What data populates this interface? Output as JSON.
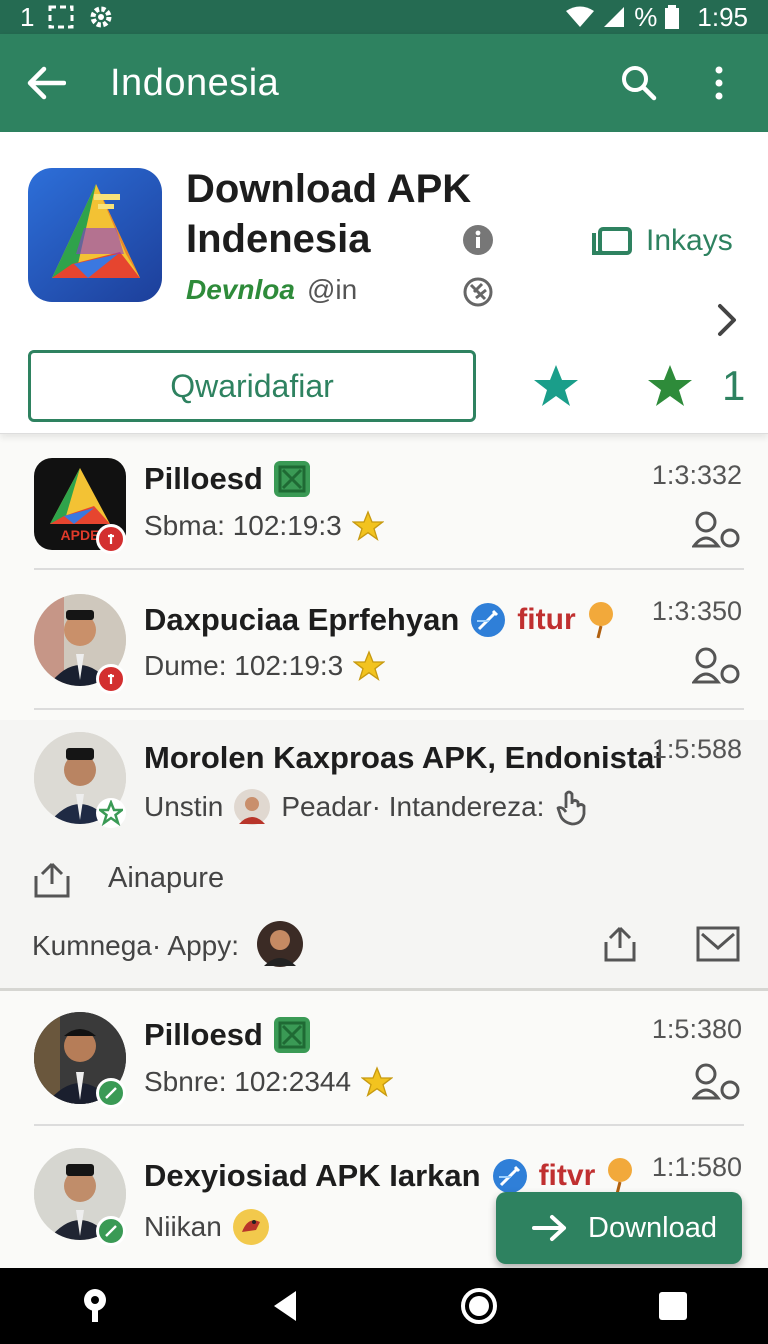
{
  "status": {
    "left_text": "1",
    "battery_pct": "%",
    "time": "1:95"
  },
  "app_bar": {
    "title": "Indonesia"
  },
  "header": {
    "title_line1": "Download APK",
    "title_line2": "Indenesia",
    "sub_green": "Devnloa",
    "sub_gray": "@in",
    "side_link": "Inkays",
    "primary_button": "Qwaridafiar",
    "count": "1"
  },
  "items": [
    {
      "name": "Pilloesd",
      "sub": "Sbma: 102:19:3",
      "time": "1:3:332"
    },
    {
      "name": "Daxpuciaa Eprfehyan",
      "tag": "fitur",
      "sub": "Dume: 102:19:3",
      "time": "1:3:350"
    },
    {
      "name": "Morolen Kaxproas APK, Endonistai",
      "sub_a": "Unstin",
      "sub_b": "Peadar· Intandereza:",
      "time": "1:5:588"
    },
    {
      "name": "Pilloesd",
      "sub": "Sbnre: 102:2344",
      "time": "1:5:380"
    },
    {
      "name": "Dexyiosiad APK Iarkan",
      "tag": "fitvr",
      "sub": "Niikan",
      "time": "1:1:580"
    }
  ],
  "expanded": {
    "label": "Ainapure",
    "share_label": "Kumnega· Appy:"
  },
  "app_icon_text": "APDE",
  "fab": {
    "label": "Download"
  },
  "colors": {
    "primary": "#2e8260",
    "status": "#256b52",
    "badge_red": "#d32f2f",
    "badge_green": "#3a9a55",
    "star_teal": "#1a9e8a",
    "star_green": "#2e8b3a"
  },
  "icons": [
    "back-arrow-icon",
    "search-icon",
    "more-vert-icon",
    "info-icon",
    "no-ads-icon",
    "chevron-right-icon",
    "copy-icon",
    "star-icon",
    "people-icon",
    "verified-icon",
    "share-icon",
    "mail-icon",
    "arrow-right-icon"
  ]
}
